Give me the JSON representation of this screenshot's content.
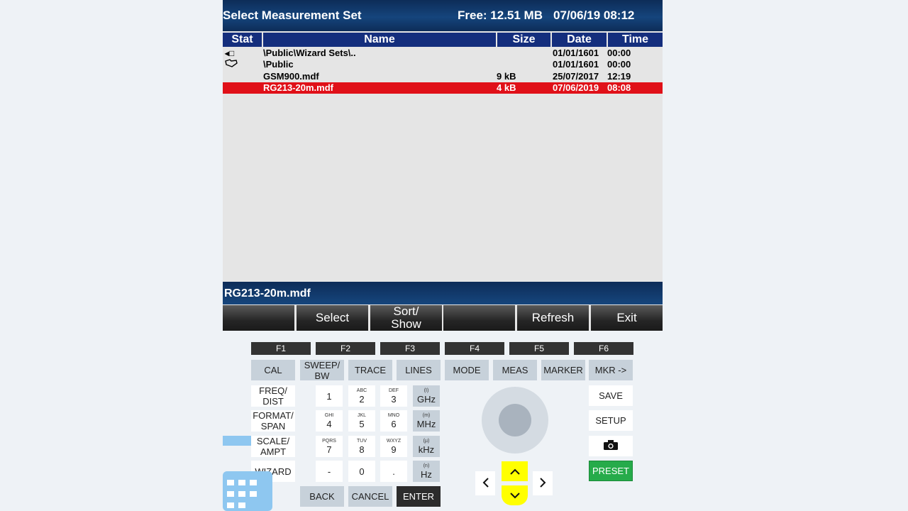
{
  "title_bar": {
    "title": "Select Measurement Set",
    "free": "Free: 12.51 MB",
    "datetime": "07/06/19 08:12"
  },
  "columns": [
    "Stat",
    "Name",
    "Size",
    "Date",
    "Time"
  ],
  "files": [
    {
      "icon": "folder-up-icon",
      "name": "\\Public\\Wizard Sets\\..",
      "size": "",
      "date": "01/01/1601",
      "time": "00:00",
      "selected": false
    },
    {
      "icon": "folder-open-icon",
      "name": "\\Public",
      "size": "",
      "date": "01/01/1601",
      "time": "00:00",
      "selected": false
    },
    {
      "icon": "",
      "name": "GSM900.mdf",
      "size": "9 kB",
      "date": "25/07/2017",
      "time": "12:19",
      "selected": false
    },
    {
      "icon": "",
      "name": "RG213-20m.mdf",
      "size": "4 kB",
      "date": "07/06/2019",
      "time": "08:08",
      "selected": true
    }
  ],
  "status_file": "RG213-20m.mdf",
  "softkeys": [
    "",
    "Select",
    "Sort/\nShow",
    "",
    "Refresh",
    "Exit"
  ],
  "fkeys": [
    "F1",
    "F2",
    "F3",
    "F4",
    "F5",
    "F6"
  ],
  "hard_keys": [
    "CAL",
    "SWEEP/\nBW",
    "TRACE",
    "LINES",
    "MODE",
    "MEAS",
    "MARKER",
    "MKR ->"
  ],
  "left_keys": [
    "FREQ/\nDIST",
    "FORMAT/\nSPAN",
    "SCALE/\nAMPT",
    "WIZARD"
  ],
  "num_keys": [
    {
      "sub": "",
      "main": "1"
    },
    {
      "sub": "ABC",
      "main": "2"
    },
    {
      "sub": "DEF",
      "main": "3"
    },
    {
      "sub": "(I)",
      "main": "GHz"
    },
    {
      "sub": "GHI",
      "main": "4"
    },
    {
      "sub": "JKL",
      "main": "5"
    },
    {
      "sub": "MNO",
      "main": "6"
    },
    {
      "sub": "(m)",
      "main": "MHz"
    },
    {
      "sub": "PQRS",
      "main": "7"
    },
    {
      "sub": "TUV",
      "main": "8"
    },
    {
      "sub": "WXYZ",
      "main": "9"
    },
    {
      "sub": "(µ)",
      "main": "kHz"
    },
    {
      "sub": "",
      "main": "-"
    },
    {
      "sub": "",
      "main": "0"
    },
    {
      "sub": "",
      "main": "."
    },
    {
      "sub": "(n)",
      "main": "Hz"
    }
  ],
  "bottom_keys": [
    "BACK",
    "CANCEL",
    "ENTER"
  ],
  "right_keys": [
    "SAVE",
    "SETUP",
    "camera-icon",
    "PRESET"
  ],
  "colors": {
    "title_bg": "#0d2c58",
    "header_bg": "#142e7d",
    "selected_row": "#e01018",
    "preset": "#26ab4a",
    "highlight": "#ffff00"
  }
}
